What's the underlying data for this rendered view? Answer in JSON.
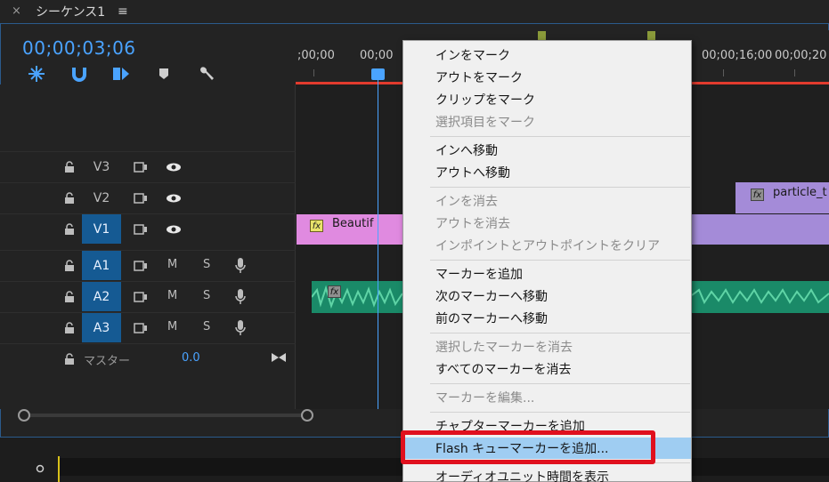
{
  "header": {
    "close_label": "×",
    "sequence_title": "シーケンス1",
    "menu_glyph": "≡"
  },
  "timecode": "00;00;03;06",
  "ruler": {
    "labels": [
      ";00;00",
      "00;00",
      "00;00;16;00",
      "00;00;20"
    ]
  },
  "tracks": [
    {
      "name": "V3",
      "type": "video",
      "active": false
    },
    {
      "name": "V2",
      "type": "video",
      "active": false
    },
    {
      "name": "V1",
      "type": "video",
      "active": true
    },
    {
      "name": "A1",
      "type": "audio",
      "active": true
    },
    {
      "name": "A2",
      "type": "audio",
      "active": true
    },
    {
      "name": "A3",
      "type": "audio",
      "active": true
    }
  ],
  "audio_controls": {
    "mute_label": "M",
    "solo_label": "S"
  },
  "master": {
    "label": "マスター",
    "value": "0.0"
  },
  "clips": {
    "v1_clip_label": "Beautif",
    "v2_clip_label": "particle_t",
    "fx_label": "fx"
  },
  "context_menu": {
    "items": [
      {
        "label": "インをマーク",
        "disabled": false
      },
      {
        "label": "アウトをマーク",
        "disabled": false
      },
      {
        "label": "クリップをマーク",
        "disabled": false
      },
      {
        "label": "選択項目をマーク",
        "disabled": true
      },
      {
        "label": "インへ移動",
        "disabled": false
      },
      {
        "label": "アウトへ移動",
        "disabled": false
      },
      {
        "label": "インを消去",
        "disabled": true
      },
      {
        "label": "アウトを消去",
        "disabled": true
      },
      {
        "label": "インポイントとアウトポイントをクリア",
        "disabled": true
      },
      {
        "label": "マーカーを追加",
        "disabled": false
      },
      {
        "label": "次のマーカーへ移動",
        "disabled": false
      },
      {
        "label": "前のマーカーへ移動",
        "disabled": false
      },
      {
        "label": "選択したマーカーを消去",
        "disabled": true
      },
      {
        "label": "すべてのマーカーを消去",
        "disabled": false
      },
      {
        "label": "マーカーを編集...",
        "disabled": true
      },
      {
        "label": "チャプターマーカーを追加",
        "disabled": false
      },
      {
        "label": "Flash キューマーカーを追加...",
        "disabled": false,
        "highlighted": true
      },
      {
        "label": "オーディオユニット時間を表示",
        "disabled": false
      }
    ]
  },
  "colors": {
    "accent": "#4aa3ff",
    "track_active": "#155a93",
    "red_bar": "#e23b2e",
    "highlight_box": "#e0101e",
    "menu_highlight": "#9fcdf2"
  }
}
